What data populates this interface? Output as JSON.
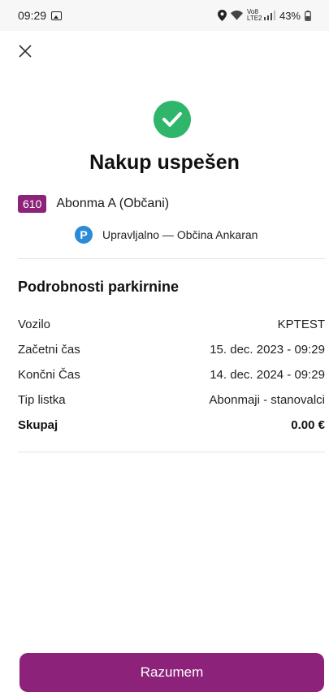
{
  "status_bar": {
    "time": "09:29",
    "network_label": "Vo8 LTE2",
    "battery": "43%"
  },
  "page": {
    "title": "Nakup uspešen"
  },
  "zone": {
    "code": "610",
    "name": "Abonma A (Občani)"
  },
  "operator": {
    "icon_letter": "P",
    "label": "Upravljalno — Občina Ankaran"
  },
  "details": {
    "heading": "Podrobnosti parkirnine",
    "rows": [
      {
        "label": "Vozilo",
        "value": "KPTEST"
      },
      {
        "label": "Začetni čas",
        "value": "15. dec. 2023 - 09:29"
      },
      {
        "label": "Končni Čas",
        "value": "14. dec. 2024 - 09:29"
      },
      {
        "label": "Tip listka",
        "value": "Abonmaji - stanovalci"
      },
      {
        "label": "Skupaj",
        "value": "0.00 €"
      }
    ]
  },
  "actions": {
    "confirm_label": "Razumem"
  },
  "colors": {
    "brand": "#8c2279",
    "success": "#2fb66b",
    "parking_blue": "#2c8bd6"
  }
}
